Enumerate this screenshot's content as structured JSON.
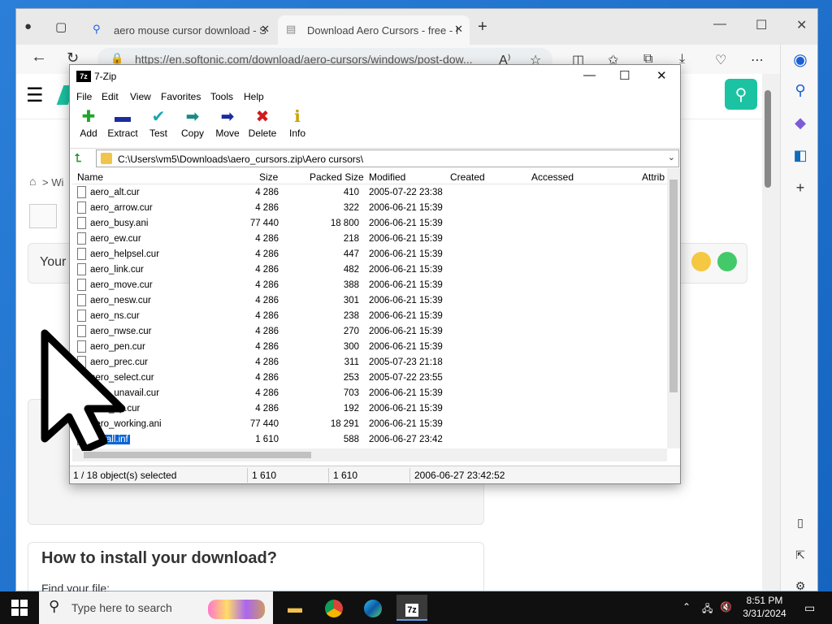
{
  "browser": {
    "tabs": [
      {
        "label": "aero mouse cursor download - S",
        "icon": "search-icon"
      },
      {
        "label": "Download Aero Cursors - free - I",
        "icon": "page-icon"
      }
    ],
    "new_tab": "+",
    "url": "https://en.softonic.com/download/aero-cursors/windows/post-dow...",
    "page": {
      "breadcrumb": "> Wi",
      "card_label": "Your",
      "howto_title": "How to install your download?",
      "find_file": "Find your file:"
    }
  },
  "zip": {
    "title": "7-Zip",
    "menu": [
      "File",
      "Edit",
      "View",
      "Favorites",
      "Tools",
      "Help"
    ],
    "toolbar": [
      {
        "label": "Add",
        "icon": "plus-icon",
        "glyph": "✚",
        "color": "#1fa52b"
      },
      {
        "label": "Extract",
        "icon": "minus-icon",
        "glyph": "▬",
        "color": "#1b2c9f"
      },
      {
        "label": "Test",
        "icon": "check-icon",
        "glyph": "✔",
        "color": "#18a8b4"
      },
      {
        "label": "Copy",
        "icon": "copy-arrow-icon",
        "glyph": "➡",
        "color": "#1b8c82"
      },
      {
        "label": "Move",
        "icon": "move-arrow-icon",
        "glyph": "➡",
        "color": "#1b2c9f"
      },
      {
        "label": "Delete",
        "icon": "delete-x-icon",
        "glyph": "✖",
        "color": "#d21b1b"
      },
      {
        "label": "Info",
        "icon": "info-icon",
        "glyph": "ℹ",
        "color": "#c9a200"
      }
    ],
    "path": "C:\\Users\\vm5\\Downloads\\aero_cursors.zip\\Aero cursors\\",
    "columns": [
      "Name",
      "Size",
      "Packed Size",
      "Modified",
      "Created",
      "Accessed",
      "Attrib"
    ],
    "files": [
      {
        "name": "aero_alt.cur",
        "size": "4 286",
        "packed": "410",
        "modified": "2005-07-22 23:38"
      },
      {
        "name": "aero_arrow.cur",
        "size": "4 286",
        "packed": "322",
        "modified": "2006-06-21 15:39"
      },
      {
        "name": "aero_busy.ani",
        "size": "77 440",
        "packed": "18 800",
        "modified": "2006-06-21 15:39"
      },
      {
        "name": "aero_ew.cur",
        "size": "4 286",
        "packed": "218",
        "modified": "2006-06-21 15:39"
      },
      {
        "name": "aero_helpsel.cur",
        "size": "4 286",
        "packed": "447",
        "modified": "2006-06-21 15:39"
      },
      {
        "name": "aero_link.cur",
        "size": "4 286",
        "packed": "482",
        "modified": "2006-06-21 15:39"
      },
      {
        "name": "aero_move.cur",
        "size": "4 286",
        "packed": "388",
        "modified": "2006-06-21 15:39"
      },
      {
        "name": "aero_nesw.cur",
        "size": "4 286",
        "packed": "301",
        "modified": "2006-06-21 15:39"
      },
      {
        "name": "aero_ns.cur",
        "size": "4 286",
        "packed": "238",
        "modified": "2006-06-21 15:39"
      },
      {
        "name": "aero_nwse.cur",
        "size": "4 286",
        "packed": "270",
        "modified": "2006-06-21 15:39"
      },
      {
        "name": "aero_pen.cur",
        "size": "4 286",
        "packed": "300",
        "modified": "2006-06-21 15:39"
      },
      {
        "name": "aero_prec.cur",
        "size": "4 286",
        "packed": "311",
        "modified": "2005-07-23 21:18"
      },
      {
        "name": "aero_select.cur",
        "size": "4 286",
        "packed": "253",
        "modified": "2005-07-22 23:55"
      },
      {
        "name": "aero_unavail.cur",
        "size": "4 286",
        "packed": "703",
        "modified": "2006-06-21 15:39"
      },
      {
        "name": "aero_up.cur",
        "size": "4 286",
        "packed": "192",
        "modified": "2006-06-21 15:39"
      },
      {
        "name": "aero_working.ani",
        "size": "77 440",
        "packed": "18 291",
        "modified": "2006-06-21 15:39"
      },
      {
        "name": "install.inf",
        "size": "1 610",
        "packed": "588",
        "modified": "2006-06-27 23:42",
        "selected": true
      }
    ],
    "status": {
      "selection": "1 / 18 object(s) selected",
      "size": "1 610",
      "packed": "1 610",
      "modified": "2006-06-27 23:42:52"
    }
  },
  "taskbar": {
    "search_placeholder": "Type here to search",
    "time": "8:51 PM",
    "date": "3/31/2024"
  }
}
